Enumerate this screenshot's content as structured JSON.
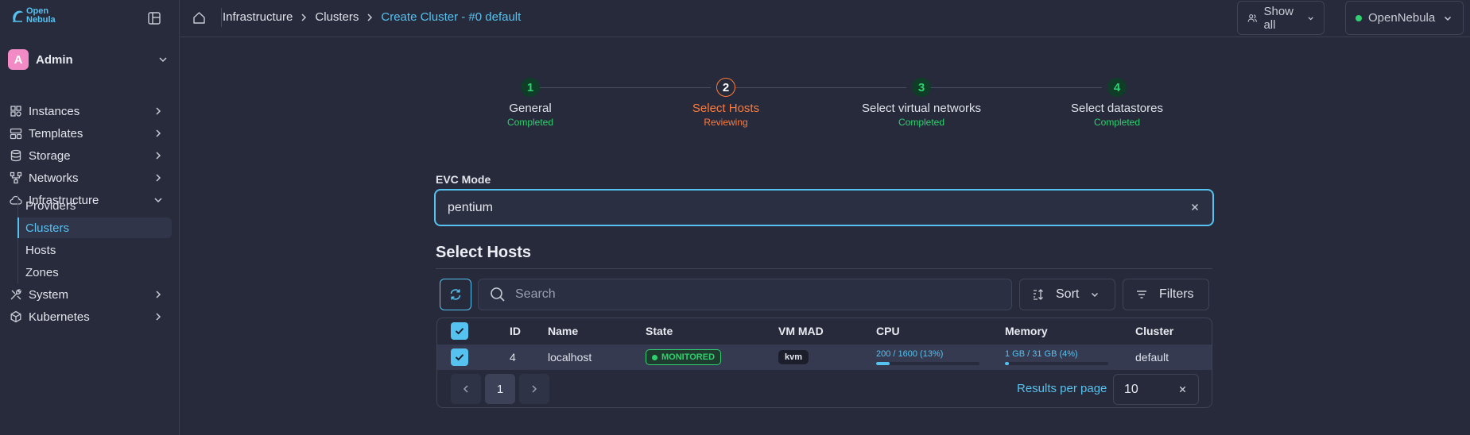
{
  "app": {
    "logo_text": "Open Nebula",
    "accent_color": "#56c2f0",
    "success_color": "#2fd06f",
    "warning_color": "#ff7a3d"
  },
  "sidebar": {
    "user": {
      "initial": "A",
      "name": "Admin"
    },
    "items": [
      {
        "label": "Instances",
        "icon": "instances-icon"
      },
      {
        "label": "Templates",
        "icon": "templates-icon"
      },
      {
        "label": "Storage",
        "icon": "storage-icon"
      },
      {
        "label": "Networks",
        "icon": "networks-icon"
      },
      {
        "label": "Infrastructure",
        "icon": "cloud-icon",
        "expanded": true
      },
      {
        "label": "System",
        "icon": "system-icon"
      },
      {
        "label": "Kubernetes",
        "icon": "kubernetes-icon"
      }
    ],
    "infra_sub": [
      {
        "label": "Providers"
      },
      {
        "label": "Clusters",
        "active": true
      },
      {
        "label": "Hosts"
      },
      {
        "label": "Zones"
      }
    ]
  },
  "topbar": {
    "breadcrumbs": [
      "Infrastructure",
      "Clusters",
      "Create Cluster - #0 default"
    ],
    "show_all_label": "Show all",
    "zone_label": "OpenNebula"
  },
  "stepper": {
    "steps": [
      {
        "number": "1",
        "title": "General",
        "status": "Completed",
        "state": "done"
      },
      {
        "number": "2",
        "title": "Select Hosts",
        "status": "Reviewing",
        "state": "active"
      },
      {
        "number": "3",
        "title": "Select virtual networks",
        "status": "Completed",
        "state": "done"
      },
      {
        "number": "4",
        "title": "Select datastores",
        "status": "Completed",
        "state": "done"
      }
    ]
  },
  "evc": {
    "label": "EVC Mode",
    "value": "pentium"
  },
  "hosts": {
    "section_title": "Select Hosts",
    "search_placeholder": "Search",
    "sort_label": "Sort",
    "filters_label": "Filters",
    "columns": [
      "ID",
      "Name",
      "State",
      "VM MAD",
      "CPU",
      "Memory",
      "Cluster"
    ],
    "rows": [
      {
        "id": "4",
        "name": "localhost",
        "state": "MONITORED",
        "vm_mad": "kvm",
        "cpu_text": "200 / 1600 (13%)",
        "cpu_fraction": 0.13,
        "memory_text": "1 GB / 31 GB (4%)",
        "memory_fraction": 0.04,
        "cluster": "default",
        "selected": true
      }
    ],
    "pagination": {
      "current_page": "1",
      "results_per_page_label": "Results per page",
      "results_per_page": "10"
    }
  }
}
